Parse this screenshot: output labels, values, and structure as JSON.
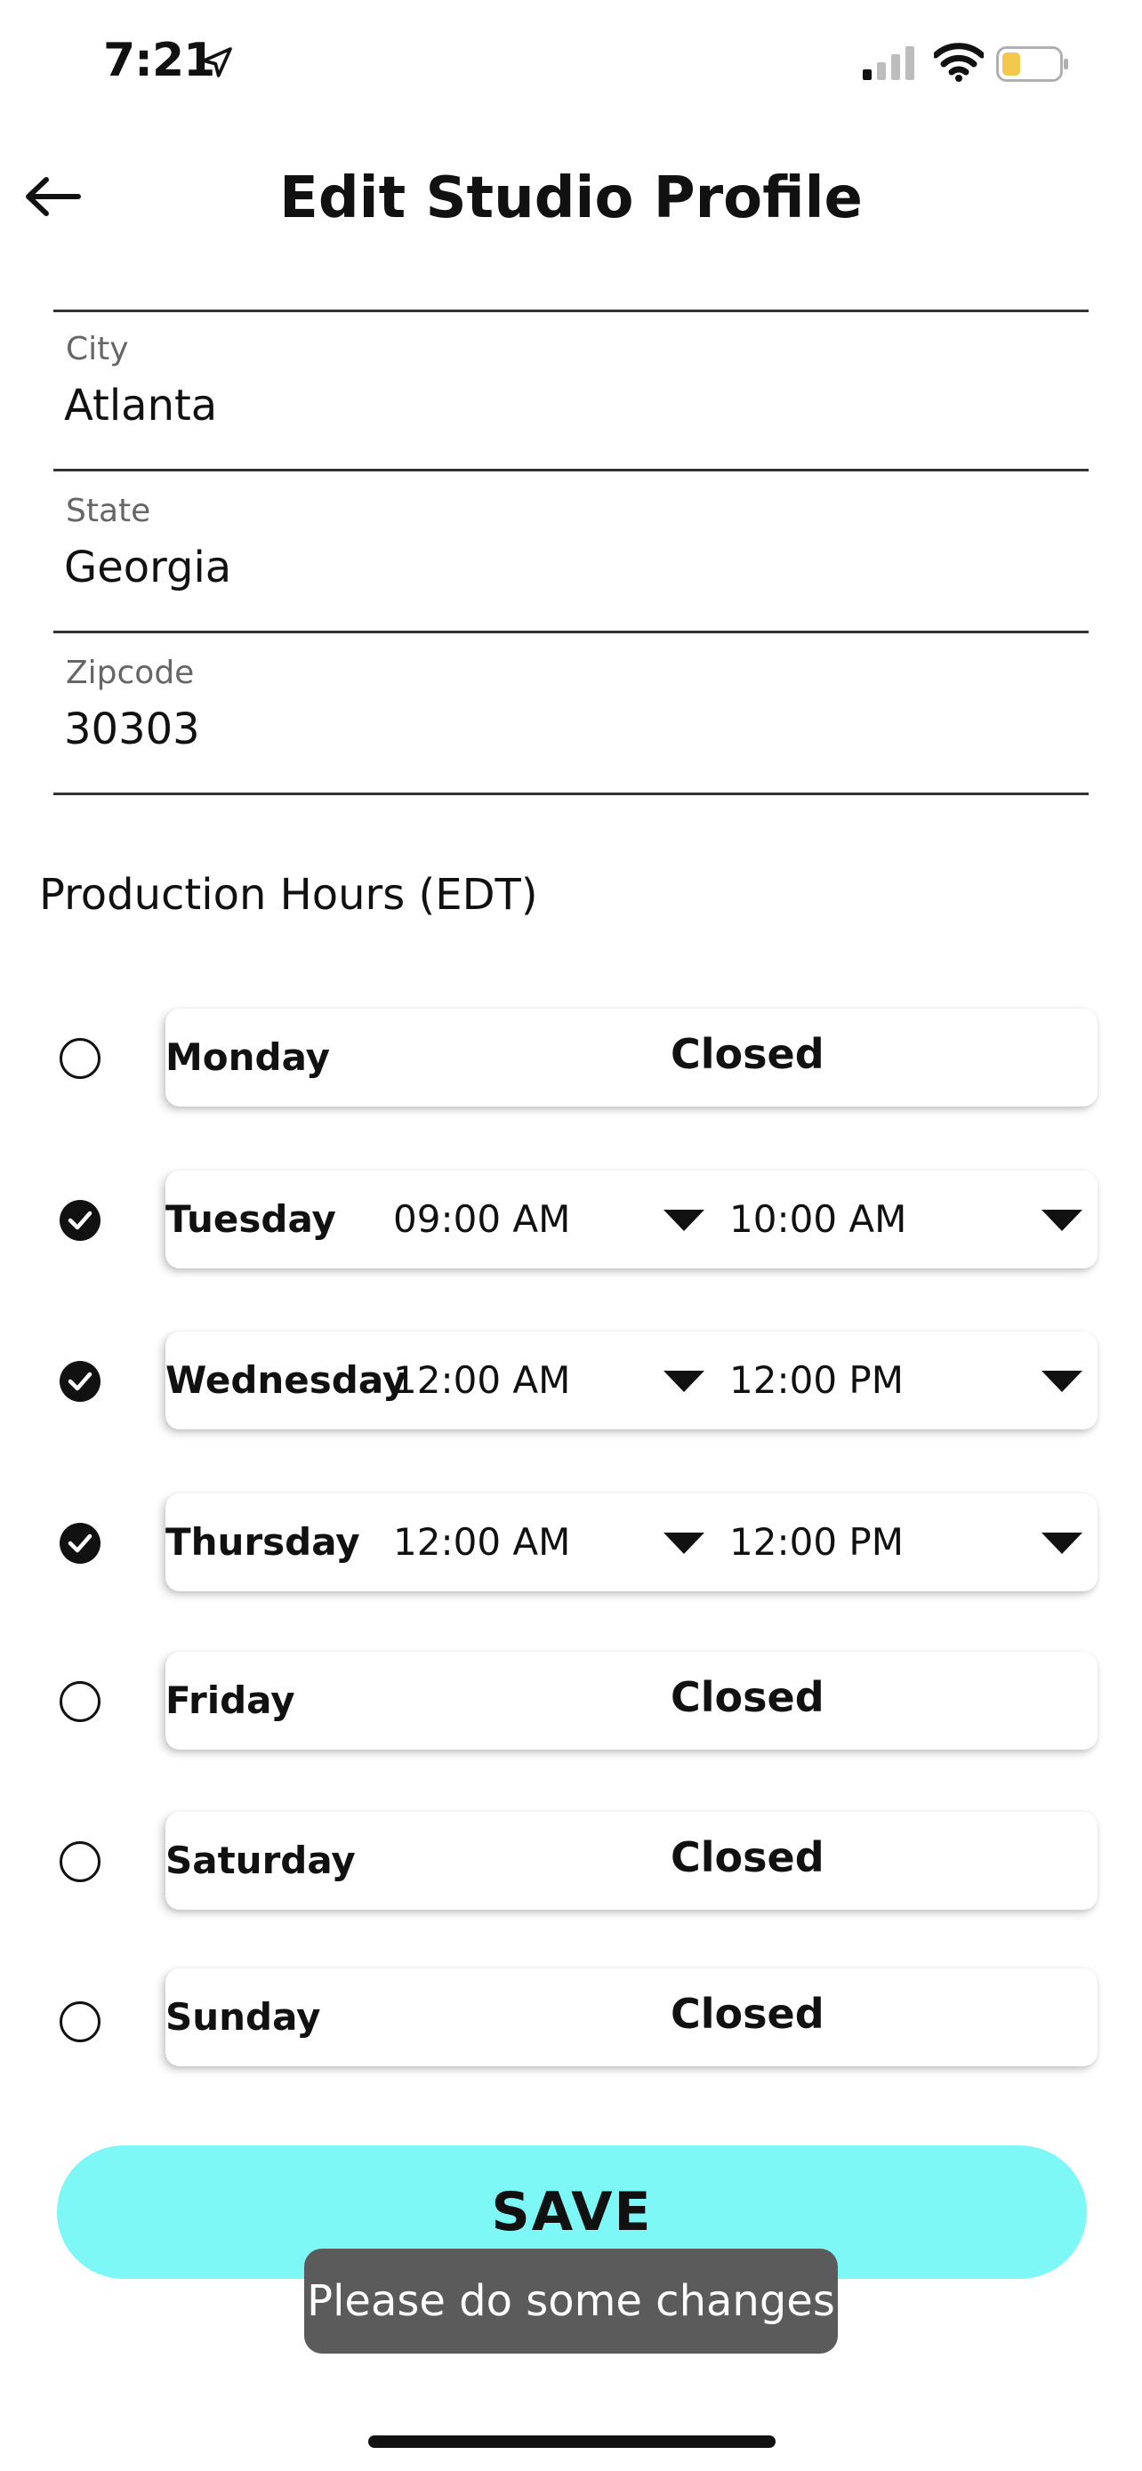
{
  "status_bar": {
    "time": "7:21",
    "icons": [
      "location-arrow-icon",
      "cellular-signal-icon",
      "wifi-icon",
      "battery-low-icon"
    ],
    "battery_color": "#f2c94c"
  },
  "header": {
    "title": "Edit Studio Profile",
    "back_icon": "arrow-left-icon"
  },
  "fields": [
    {
      "label": "City",
      "value": "Atlanta"
    },
    {
      "label": "State",
      "value": "Georgia"
    },
    {
      "label": "Zipcode",
      "value": "30303"
    }
  ],
  "production_hours": {
    "title": "Production Hours (EDT)",
    "days": [
      {
        "name": "Monday",
        "checked": false,
        "closed_label": "Closed"
      },
      {
        "name": "Tuesday",
        "checked": true,
        "open": "09:00 AM",
        "close": "10:00 AM"
      },
      {
        "name": "Wednesday",
        "checked": true,
        "open": "12:00 AM",
        "close": "12:00 PM"
      },
      {
        "name": "Thursday",
        "checked": true,
        "open": "12:00 AM",
        "close": "12:00 PM"
      },
      {
        "name": "Friday",
        "checked": false,
        "closed_label": "Closed"
      },
      {
        "name": "Saturday",
        "checked": false,
        "closed_label": "Closed"
      },
      {
        "name": "Sunday",
        "checked": false,
        "closed_label": "Closed"
      }
    ]
  },
  "save_button": {
    "label": "SAVE",
    "color": "#7df8f7"
  },
  "toast": {
    "message": "Please do some changes"
  }
}
